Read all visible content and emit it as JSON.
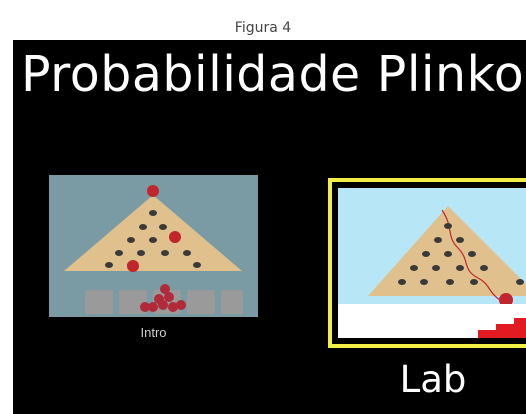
{
  "caption": "Figura 4",
  "app": {
    "title": "Probabilidade Plinko"
  },
  "screens": {
    "intro": {
      "label": "Intro"
    },
    "lab": {
      "label": "Lab"
    }
  },
  "colors": {
    "background": "#000000",
    "highlight_border": "#f2f046",
    "ball": "#c0262c",
    "board": "#e0c08c",
    "histogram": "#e21b22"
  }
}
